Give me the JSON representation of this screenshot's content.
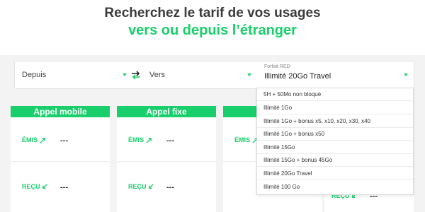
{
  "header": {
    "title_line1": "Recherchez le tarif de vos usages",
    "title_line2": "vers ou depuis l’étranger"
  },
  "filters": {
    "from_label": "Depuis",
    "to_label": "Vers",
    "plan_small_label": "Forfait RED",
    "plan_value": "Illimité 20Go Travel"
  },
  "dropdown": {
    "options": [
      "5H + 50Mo non bloqué",
      "Illimité 1Go",
      "Illimité 1Go + bonus x5, x10, x20, x30, x40",
      "Illimité 1Go + bonus x50",
      "Illimité 15Go",
      "Illimité 15Go + bonus 45Go",
      "Illimité 20Go Travel",
      "Illimité 100 Go"
    ]
  },
  "cards": [
    {
      "title": "Appel mobile",
      "emis_label": "ÉMIS",
      "emis_value": "---",
      "recu_label": "REÇU",
      "recu_value": "---"
    },
    {
      "title": "Appel fixe",
      "emis_label": "ÉMIS",
      "emis_value": "---",
      "recu_label": "REÇU",
      "recu_value": "---"
    },
    {
      "title": "",
      "emis_label": "ÉMIS",
      "emis_value": "---",
      "recu_label": "",
      "recu_value": ""
    },
    {
      "title": "",
      "emis_label": "",
      "emis_value": "",
      "recu_label": "REÇU",
      "recu_value": "---"
    }
  ],
  "colors": {
    "accent": "#19cf6b",
    "text": "#3b3b3b",
    "background": "#f3f3f3"
  }
}
